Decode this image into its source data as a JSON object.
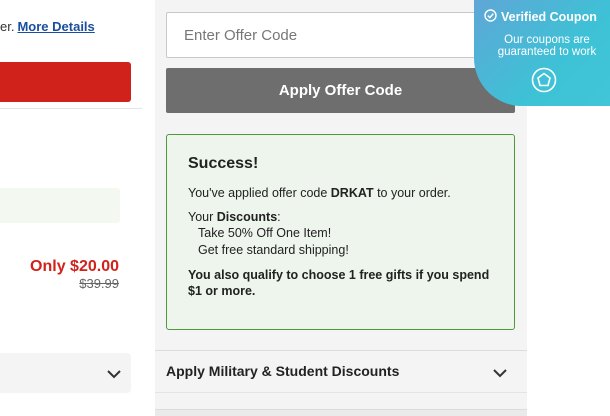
{
  "left_panel": {
    "more_prefix": "er.",
    "more_link": "More Details",
    "price_now": "Only $20.00",
    "price_was": "$39.99"
  },
  "offer": {
    "input_placeholder": "Enter Offer Code",
    "input_value": "",
    "apply_label": "Apply Offer Code"
  },
  "success": {
    "title": "Success!",
    "applied_prefix": "You've applied offer code ",
    "code": "DRKAT",
    "applied_suffix": " to your order.",
    "discounts_prefix": "Your ",
    "discounts_bold": "Discounts",
    "discounts_suffix": ":",
    "discounts": [
      "Take 50% Off One Item!",
      "Get free standard shipping!"
    ],
    "qualify": "You also qualify to choose 1 free gifts if you spend $1 or more."
  },
  "military": {
    "label": "Apply Military & Student Discounts"
  },
  "verified_badge": {
    "title": "Verified Coupon",
    "subtitle": "Our coupons are guaranteed to work"
  },
  "colors": {
    "accent_red": "#d0221a",
    "link_blue": "#1a4fa0",
    "success_green": "#4e9a3a",
    "badge_blue": "#3ec1d6",
    "button_gray": "#6e6e6e"
  }
}
